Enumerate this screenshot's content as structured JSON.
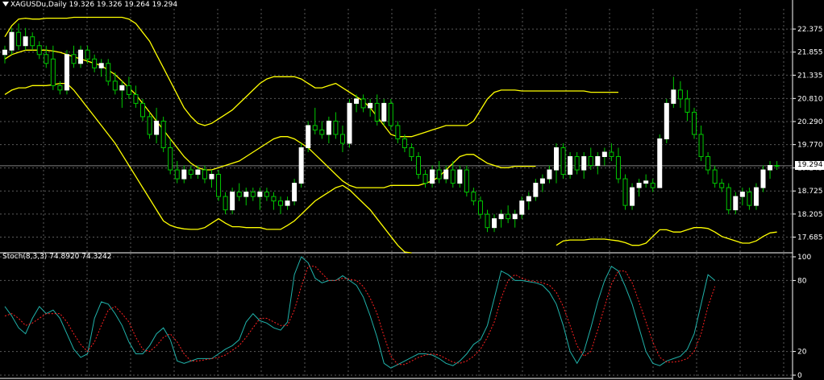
{
  "window": {
    "symbol_header": "XAGUSDu,Daily  19.326 19.326 19.264 19.294",
    "indicator_header": "Stoch(8,3,3) 74.8920 74.3242",
    "current_price_label": "19.294"
  },
  "colors": {
    "background": "#000000",
    "grid": "#5a5a5a",
    "axis": "#ffffff",
    "bull_candle": "#ffffff",
    "bear_candle": "#000000",
    "wick_and_bear_outline": "#00c800",
    "bollinger": "#ffff00",
    "stoch_main": "#20b2aa",
    "stoch_signal": "#ff2020"
  },
  "chart_data": [
    {
      "type": "candlestick",
      "symbol": "XAGUSDu",
      "timeframe": "Daily",
      "y_ticks": [
        "22.375",
        "21.855",
        "21.335",
        "20.810",
        "20.290",
        "19.770",
        "19.245",
        "18.725",
        "18.205",
        "17.685"
      ],
      "ylim": [
        17.35,
        22.83
      ],
      "current_price": 19.294,
      "ohlc": [
        [
          21.8,
          22.0,
          21.6,
          21.9
        ],
        [
          21.9,
          22.4,
          21.8,
          22.3
        ],
        [
          22.3,
          22.5,
          21.9,
          22.0
        ],
        [
          22.0,
          22.4,
          21.9,
          22.2
        ],
        [
          22.2,
          22.3,
          21.9,
          22.0
        ],
        [
          22.0,
          22.1,
          21.7,
          21.8
        ],
        [
          21.8,
          22.0,
          21.5,
          21.6
        ],
        [
          21.7,
          22.0,
          21.0,
          21.1
        ],
        [
          21.1,
          21.2,
          20.9,
          21.0
        ],
        [
          21.0,
          21.9,
          20.9,
          21.8
        ],
        [
          21.8,
          22.0,
          21.5,
          21.6
        ],
        [
          21.6,
          22.0,
          21.5,
          21.9
        ],
        [
          21.9,
          22.0,
          21.6,
          21.7
        ],
        [
          21.7,
          21.8,
          21.4,
          21.5
        ],
        [
          21.5,
          21.7,
          21.3,
          21.6
        ],
        [
          21.6,
          21.7,
          21.1,
          21.2
        ],
        [
          21.2,
          21.4,
          20.9,
          21.0
        ],
        [
          21.0,
          21.2,
          20.6,
          21.1
        ],
        [
          21.1,
          21.3,
          20.8,
          20.9
        ],
        [
          20.9,
          21.1,
          20.6,
          20.7
        ],
        [
          20.7,
          20.8,
          20.3,
          20.4
        ],
        [
          20.4,
          20.5,
          19.9,
          20.0
        ],
        [
          20.0,
          20.6,
          19.8,
          20.3
        ],
        [
          20.3,
          20.4,
          19.6,
          19.7
        ],
        [
          19.7,
          19.9,
          19.1,
          19.2
        ],
        [
          19.2,
          19.4,
          18.9,
          19.0
        ],
        [
          19.0,
          19.3,
          18.9,
          19.2
        ],
        [
          19.2,
          19.3,
          19.0,
          19.1
        ],
        [
          19.1,
          19.3,
          19.0,
          19.2
        ],
        [
          19.2,
          19.3,
          18.9,
          19.0
        ],
        [
          19.0,
          19.2,
          18.8,
          19.1
        ],
        [
          19.1,
          19.2,
          18.5,
          18.6
        ],
        [
          18.6,
          18.7,
          18.2,
          18.3
        ],
        [
          18.3,
          18.8,
          18.2,
          18.7
        ],
        [
          18.7,
          18.9,
          18.5,
          18.6
        ],
        [
          18.6,
          18.8,
          18.4,
          18.7
        ],
        [
          18.7,
          18.8,
          18.5,
          18.6
        ],
        [
          18.6,
          18.8,
          18.3,
          18.7
        ],
        [
          18.7,
          18.8,
          18.5,
          18.6
        ],
        [
          18.6,
          18.7,
          18.3,
          18.5
        ],
        [
          18.5,
          18.6,
          18.2,
          18.4
        ],
        [
          18.4,
          18.6,
          18.3,
          18.5
        ],
        [
          18.5,
          19.0,
          18.4,
          18.9
        ],
        [
          18.9,
          19.8,
          18.8,
          19.7
        ],
        [
          19.7,
          20.3,
          19.6,
          20.2
        ],
        [
          20.2,
          20.6,
          20.0,
          20.1
        ],
        [
          20.1,
          20.3,
          19.9,
          20.0
        ],
        [
          20.0,
          20.4,
          19.8,
          20.3
        ],
        [
          20.3,
          20.5,
          19.9,
          20.0
        ],
        [
          20.0,
          20.2,
          19.6,
          19.8
        ],
        [
          19.8,
          20.8,
          19.7,
          20.7
        ],
        [
          20.7,
          20.9,
          20.5,
          20.8
        ],
        [
          20.8,
          20.9,
          20.5,
          20.6
        ],
        [
          20.6,
          20.8,
          20.4,
          20.7
        ],
        [
          20.7,
          20.9,
          20.2,
          20.3
        ],
        [
          20.3,
          20.8,
          20.2,
          20.7
        ],
        [
          20.7,
          20.8,
          20.1,
          20.2
        ],
        [
          20.2,
          20.3,
          19.8,
          19.9
        ],
        [
          19.9,
          20.0,
          19.6,
          19.7
        ],
        [
          19.7,
          19.8,
          19.4,
          19.5
        ],
        [
          19.5,
          19.6,
          19.0,
          19.1
        ],
        [
          19.1,
          19.2,
          18.8,
          18.9
        ],
        [
          18.9,
          19.3,
          18.8,
          19.2
        ],
        [
          19.2,
          19.4,
          18.9,
          19.0
        ],
        [
          19.0,
          19.3,
          18.9,
          19.2
        ],
        [
          19.2,
          19.4,
          18.8,
          18.9
        ],
        [
          18.9,
          19.3,
          18.8,
          19.2
        ],
        [
          19.2,
          19.3,
          18.6,
          18.7
        ],
        [
          18.7,
          18.8,
          18.4,
          18.5
        ],
        [
          18.5,
          18.6,
          18.1,
          18.2
        ],
        [
          18.2,
          18.3,
          17.8,
          17.9
        ],
        [
          17.9,
          18.2,
          17.8,
          18.1
        ],
        [
          18.1,
          18.3,
          17.9,
          18.2
        ],
        [
          18.2,
          18.4,
          18.0,
          18.1
        ],
        [
          18.1,
          18.3,
          17.9,
          18.2
        ],
        [
          18.2,
          18.6,
          18.1,
          18.5
        ],
        [
          18.5,
          18.7,
          18.3,
          18.6
        ],
        [
          18.6,
          19.0,
          18.5,
          18.9
        ],
        [
          18.9,
          19.1,
          18.7,
          19.0
        ],
        [
          19.0,
          19.3,
          18.9,
          19.2
        ],
        [
          19.2,
          19.8,
          18.9,
          19.7
        ],
        [
          19.7,
          19.8,
          19.0,
          19.1
        ],
        [
          19.1,
          19.6,
          19.0,
          19.5
        ],
        [
          19.5,
          19.6,
          19.1,
          19.2
        ],
        [
          19.2,
          19.6,
          19.0,
          19.5
        ],
        [
          19.5,
          19.7,
          19.2,
          19.3
        ],
        [
          19.3,
          19.6,
          19.1,
          19.5
        ],
        [
          19.5,
          19.7,
          19.3,
          19.6
        ],
        [
          19.6,
          19.8,
          19.4,
          19.5
        ],
        [
          19.5,
          19.7,
          18.9,
          19.0
        ],
        [
          19.0,
          19.1,
          18.3,
          18.4
        ],
        [
          18.4,
          18.9,
          18.3,
          18.8
        ],
        [
          18.8,
          19.0,
          18.6,
          18.9
        ],
        [
          18.9,
          19.1,
          18.8,
          18.95
        ],
        [
          18.9,
          19.0,
          18.7,
          18.8
        ],
        [
          18.8,
          20.0,
          18.8,
          19.9
        ],
        [
          19.9,
          20.8,
          19.8,
          20.7
        ],
        [
          20.7,
          21.3,
          20.6,
          21.0
        ],
        [
          21.0,
          21.2,
          20.6,
          20.8
        ],
        [
          20.8,
          21.0,
          20.3,
          20.5
        ],
        [
          20.5,
          20.6,
          19.9,
          20.0
        ],
        [
          20.0,
          20.2,
          19.4,
          19.5
        ],
        [
          19.5,
          19.6,
          19.1,
          19.2
        ],
        [
          19.2,
          19.3,
          18.8,
          18.9
        ],
        [
          18.9,
          19.0,
          18.7,
          18.8
        ],
        [
          18.8,
          18.9,
          18.2,
          18.3
        ],
        [
          18.3,
          18.7,
          18.2,
          18.6
        ],
        [
          18.6,
          18.8,
          18.4,
          18.7
        ],
        [
          18.7,
          18.8,
          18.3,
          18.4
        ],
        [
          18.4,
          18.9,
          18.3,
          18.8
        ],
        [
          18.8,
          19.3,
          18.7,
          19.2
        ],
        [
          19.2,
          19.4,
          19.0,
          19.3
        ],
        [
          19.3,
          19.4,
          19.2,
          19.294
        ]
      ],
      "bollinger_upper": [
        22.2,
        22.45,
        22.6,
        22.62,
        22.6,
        22.6,
        22.62,
        22.62,
        22.62,
        22.62,
        22.64,
        22.64,
        22.64,
        22.64,
        22.64,
        22.64,
        22.64,
        22.64,
        22.6,
        22.5,
        22.3,
        22.1,
        21.8,
        21.5,
        21.2,
        20.9,
        20.6,
        20.4,
        20.25,
        20.2,
        20.25,
        20.35,
        20.45,
        20.55,
        20.7,
        20.85,
        21.0,
        21.15,
        21.25,
        21.3,
        21.3,
        21.3,
        21.3,
        21.25,
        21.15,
        21.05,
        21.05,
        21.1,
        21.15,
        21.05,
        20.95,
        20.85,
        20.75,
        20.6,
        20.4,
        20.2,
        20.0,
        19.95,
        19.95,
        19.95,
        20.0,
        20.05,
        20.1,
        20.15,
        20.2,
        20.2,
        20.2,
        20.2,
        20.3,
        20.55,
        20.8,
        20.95,
        21.0,
        21.0,
        21.0,
        20.98,
        20.98,
        20.98,
        20.98,
        20.98,
        20.98,
        20.98,
        20.98,
        20.98,
        20.98,
        20.95,
        20.95,
        20.95,
        20.95,
        20.95
      ],
      "bollinger_middle": [
        21.7,
        21.8,
        21.85,
        21.9,
        21.9,
        21.9,
        21.9,
        21.88,
        21.85,
        21.8,
        21.75,
        21.7,
        21.65,
        21.6,
        21.55,
        21.45,
        21.35,
        21.2,
        21.05,
        20.9,
        20.7,
        20.5,
        20.3,
        20.1,
        19.9,
        19.7,
        19.5,
        19.35,
        19.25,
        19.2,
        19.2,
        19.25,
        19.3,
        19.35,
        19.4,
        19.5,
        19.6,
        19.7,
        19.8,
        19.9,
        19.95,
        19.95,
        19.9,
        19.8,
        19.7,
        19.55,
        19.4,
        19.25,
        19.1,
        18.95,
        18.85,
        18.8,
        18.8,
        18.8,
        18.8,
        18.8,
        18.85,
        18.85,
        18.85,
        18.85,
        18.85,
        18.9,
        18.95,
        19.05,
        19.2,
        19.35,
        19.5,
        19.55,
        19.55,
        19.45,
        19.35,
        19.3,
        19.25,
        19.25,
        19.28,
        19.28,
        19.28,
        19.28
      ],
      "bollinger_lower": [
        20.9,
        21.0,
        21.05,
        21.05,
        21.1,
        21.1,
        21.1,
        21.12,
        21.15,
        21.15,
        21.0,
        20.8,
        20.6,
        20.4,
        20.2,
        20.0,
        19.8,
        19.55,
        19.3,
        19.05,
        18.8,
        18.55,
        18.3,
        18.05,
        17.95,
        17.9,
        17.87,
        17.86,
        17.86,
        17.9,
        18.0,
        18.1,
        18.0,
        17.92,
        17.92,
        17.9,
        17.9,
        17.9,
        17.86,
        17.86,
        17.86,
        17.95,
        18.05,
        18.2,
        18.35,
        18.5,
        18.6,
        18.7,
        18.8,
        18.85,
        18.75,
        18.6,
        18.45,
        18.3,
        18.1,
        17.9,
        17.7,
        17.5,
        17.35,
        17.33
      ],
      "bollinger_lower_tail": [
        17.5,
        17.6,
        17.62,
        17.62,
        17.62,
        17.64,
        17.64,
        17.64,
        17.62,
        17.6,
        17.56,
        17.5,
        17.5,
        17.55,
        17.7,
        17.85,
        17.85,
        17.8,
        17.8,
        17.85,
        17.9,
        17.9,
        17.88,
        17.8,
        17.7,
        17.65,
        17.6,
        17.55,
        17.55,
        17.6,
        17.7,
        17.78,
        17.8
      ]
    },
    {
      "type": "line",
      "title": "Stoch(8,3,3) 74.8920 74.3242",
      "y_ticks": [
        "100",
        "80",
        "20",
        "0"
      ],
      "ylim": [
        0,
        100
      ],
      "series": [
        {
          "name": "main",
          "values": [
            58,
            50,
            40,
            35,
            48,
            58,
            52,
            55,
            48,
            35,
            22,
            15,
            18,
            48,
            62,
            60,
            52,
            42,
            28,
            18,
            18,
            25,
            35,
            40,
            30,
            12,
            10,
            12,
            14,
            14,
            14,
            18,
            22,
            25,
            30,
            45,
            52,
            46,
            44,
            40,
            38,
            45,
            85,
            100,
            95,
            82,
            78,
            80,
            80,
            84,
            80,
            76,
            66,
            50,
            32,
            10,
            6,
            9,
            12,
            15,
            18,
            18,
            17,
            14,
            10,
            8,
            12,
            18,
            26,
            30,
            42,
            65,
            88,
            85,
            80,
            80,
            79,
            78,
            76,
            70,
            60,
            42,
            20,
            10,
            20,
            40,
            62,
            80,
            92,
            88,
            75,
            60,
            40,
            20,
            10,
            8,
            12,
            14,
            16,
            22,
            35,
            60,
            85,
            80
          ]
        },
        {
          "name": "signal",
          "values": [
            50,
            52,
            48,
            42,
            44,
            48,
            52,
            52,
            52,
            45,
            35,
            26,
            20,
            28,
            42,
            55,
            58,
            52,
            45,
            32,
            22,
            20,
            25,
            32,
            35,
            28,
            18,
            12,
            12,
            13,
            14,
            15,
            17,
            21,
            25,
            32,
            40,
            48,
            48,
            45,
            42,
            42,
            55,
            75,
            92,
            92,
            86,
            80,
            80,
            82,
            81,
            80,
            75,
            65,
            52,
            33,
            16,
            9,
            9,
            12,
            15,
            17,
            18,
            17,
            14,
            11,
            10,
            12,
            16,
            22,
            32,
            45,
            65,
            80,
            85,
            82,
            80,
            79,
            78,
            76,
            70,
            58,
            42,
            25,
            16,
            20,
            38,
            58,
            77,
            88,
            88,
            78,
            62,
            45,
            28,
            15,
            11,
            11,
            12,
            14,
            20,
            35,
            58,
            75
          ]
        }
      ]
    }
  ]
}
